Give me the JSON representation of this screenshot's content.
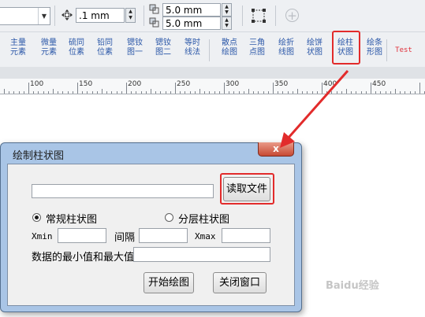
{
  "property_bar": {
    "scale_value": ".1 mm",
    "offset_x": "5.0 mm",
    "offset_y": "5.0 mm",
    "icons": [
      "position-arrows-icon",
      "offset-x-icon",
      "offset-y-icon",
      "frame-select-icon",
      "add-circle-icon"
    ]
  },
  "toolbar": {
    "buttons": [
      {
        "l1": "主量",
        "l2": "元素"
      },
      {
        "l1": "微量",
        "l2": "元素"
      },
      {
        "l1": "硫同",
        "l2": "位素"
      },
      {
        "l1": "铅同",
        "l2": "位素"
      },
      {
        "l1": "锶钕",
        "l2": "图一"
      },
      {
        "l1": "锶钕",
        "l2": "图二"
      },
      {
        "l1": "等时",
        "l2": "线法"
      },
      {
        "l1": "散点",
        "l2": "绘图"
      },
      {
        "l1": "三角",
        "l2": "点图"
      },
      {
        "l1": "绘折",
        "l2": "线图"
      },
      {
        "l1": "绘饼",
        "l2": "状图"
      },
      {
        "l1": "绘柱",
        "l2": "状图"
      },
      {
        "l1": "绘条",
        "l2": "形图"
      }
    ],
    "test_label": "Test",
    "highlight_color": "#e22b2b"
  },
  "ruler": {
    "labels": [
      "100",
      "150",
      "200",
      "250",
      "300",
      "350",
      "400",
      "450"
    ]
  },
  "dialog": {
    "title": "绘制柱状图",
    "close_glyph": "x",
    "file_path": "",
    "read_button": "读取文件",
    "radio_normal": "常规柱状图",
    "radio_layered": "分层柱状图",
    "selected": "normal",
    "xmin_label": "Xmin",
    "xmin_value": "",
    "interval_label": "间隔",
    "interval_value": "",
    "xmax_label": "Xmax",
    "xmax_value": "",
    "minmax_label": "数据的最小值和最大值",
    "minmax_value": "",
    "start_button": "开始绘图",
    "close_button": "关闭窗口"
  },
  "watermark": "Baidu经验"
}
